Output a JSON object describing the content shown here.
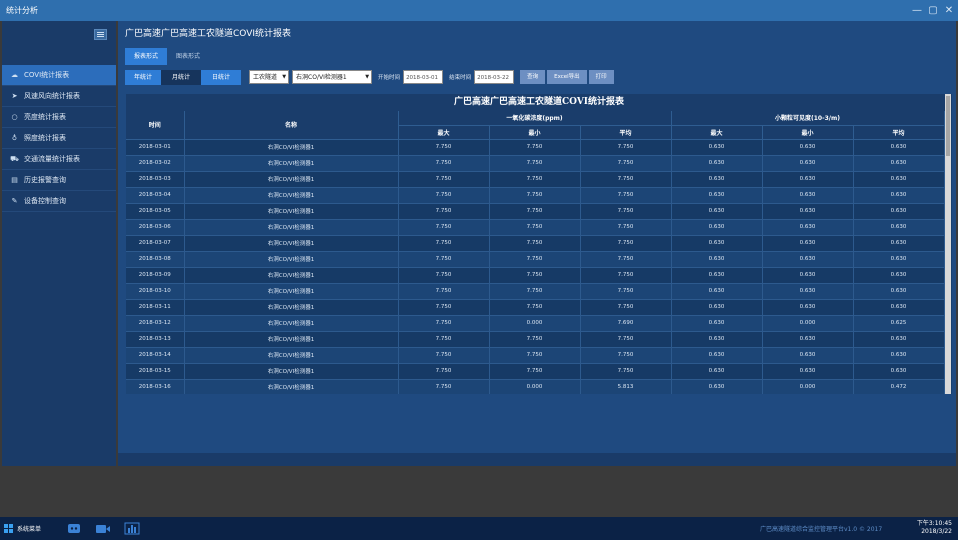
{
  "window": {
    "title": "统计分析",
    "controls": [
      "—",
      "▢",
      "✕"
    ]
  },
  "sidebar": {
    "items": [
      {
        "label": "COVI统计报表",
        "icon": "cloud-icon",
        "glyph": "☁",
        "active": true
      },
      {
        "label": "风速风向统计报表",
        "icon": "send-icon",
        "glyph": "➤",
        "active": false
      },
      {
        "label": "亮度统计报表",
        "icon": "circle-icon",
        "glyph": "○",
        "active": false
      },
      {
        "label": "照度统计报表",
        "icon": "bulb-icon",
        "glyph": "♁",
        "active": false
      },
      {
        "label": "交通流量统计报表",
        "icon": "car-icon",
        "glyph": "⛟",
        "active": false
      },
      {
        "label": "历史报警查询",
        "icon": "history-icon",
        "glyph": "▤",
        "active": false
      },
      {
        "label": "设备控制查询",
        "icon": "wrench-icon",
        "glyph": "✎",
        "active": false
      }
    ]
  },
  "page": {
    "title": "广巴高速广巴高速工农隧道COVI统计报表"
  },
  "tabs": [
    {
      "label": "报表形式",
      "active": true
    },
    {
      "label": "图表形式",
      "active": false
    }
  ],
  "toolbar": {
    "period_buttons": [
      {
        "label": "年统计",
        "active": true
      },
      {
        "label": "月统计",
        "active": false
      },
      {
        "label": "日统计",
        "active": true
      }
    ],
    "tunnel_select": "工农隧道",
    "device_select": "右洞CO/VI检测器1",
    "start_label": "开始时间",
    "start_value": "2018-03-01",
    "end_label": "结束时间",
    "end_value": "2018-03-22",
    "query_label": "查询",
    "excel_label": "Excel导出",
    "print_label": "打印"
  },
  "report": {
    "title": "广巴高速广巴高速工农隧道COVI统计报表",
    "headers": {
      "time": "时间",
      "name": "名称",
      "co_group": "一氧化碳浓度(ppm)",
      "vi_group": "小颗粒可见度(10-3/m)",
      "max": "最大",
      "min": "最小",
      "avg": "平均"
    },
    "rows": [
      [
        "2018-03-01",
        "右洞CO/VI检测器1",
        "7.750",
        "7.750",
        "7.750",
        "0.630",
        "0.630",
        "0.630"
      ],
      [
        "2018-03-02",
        "右洞CO/VI检测器1",
        "7.750",
        "7.750",
        "7.750",
        "0.630",
        "0.630",
        "0.630"
      ],
      [
        "2018-03-03",
        "右洞CO/VI检测器1",
        "7.750",
        "7.750",
        "7.750",
        "0.630",
        "0.630",
        "0.630"
      ],
      [
        "2018-03-04",
        "右洞CO/VI检测器1",
        "7.750",
        "7.750",
        "7.750",
        "0.630",
        "0.630",
        "0.630"
      ],
      [
        "2018-03-05",
        "右洞CO/VI检测器1",
        "7.750",
        "7.750",
        "7.750",
        "0.630",
        "0.630",
        "0.630"
      ],
      [
        "2018-03-06",
        "右洞CO/VI检测器1",
        "7.750",
        "7.750",
        "7.750",
        "0.630",
        "0.630",
        "0.630"
      ],
      [
        "2018-03-07",
        "右洞CO/VI检测器1",
        "7.750",
        "7.750",
        "7.750",
        "0.630",
        "0.630",
        "0.630"
      ],
      [
        "2018-03-08",
        "右洞CO/VI检测器1",
        "7.750",
        "7.750",
        "7.750",
        "0.630",
        "0.630",
        "0.630"
      ],
      [
        "2018-03-09",
        "右洞CO/VI检测器1",
        "7.750",
        "7.750",
        "7.750",
        "0.630",
        "0.630",
        "0.630"
      ],
      [
        "2018-03-10",
        "右洞CO/VI检测器1",
        "7.750",
        "7.750",
        "7.750",
        "0.630",
        "0.630",
        "0.630"
      ],
      [
        "2018-03-11",
        "右洞CO/VI检测器1",
        "7.750",
        "7.750",
        "7.750",
        "0.630",
        "0.630",
        "0.630"
      ],
      [
        "2018-03-12",
        "右洞CO/VI检测器1",
        "7.750",
        "0.000",
        "7.690",
        "0.630",
        "0.000",
        "0.625"
      ],
      [
        "2018-03-13",
        "右洞CO/VI检测器1",
        "7.750",
        "7.750",
        "7.750",
        "0.630",
        "0.630",
        "0.630"
      ],
      [
        "2018-03-14",
        "右洞CO/VI检测器1",
        "7.750",
        "7.750",
        "7.750",
        "0.630",
        "0.630",
        "0.630"
      ],
      [
        "2018-03-15",
        "右洞CO/VI检测器1",
        "7.750",
        "7.750",
        "7.750",
        "0.630",
        "0.630",
        "0.630"
      ],
      [
        "2018-03-16",
        "右洞CO/VI检测器1",
        "7.750",
        "0.000",
        "5.813",
        "0.630",
        "0.000",
        "0.472"
      ]
    ]
  },
  "taskbar": {
    "start_label": "系统菜单",
    "footer": "广巴高速隧道综合监控管理平台v1.0 © 2017",
    "time": "下午3:10:45",
    "date": "2018/3/22"
  },
  "colors": {
    "accent": "#2f7dd6",
    "panel": "#1f4a80",
    "sidebar": "#1a3b68"
  }
}
